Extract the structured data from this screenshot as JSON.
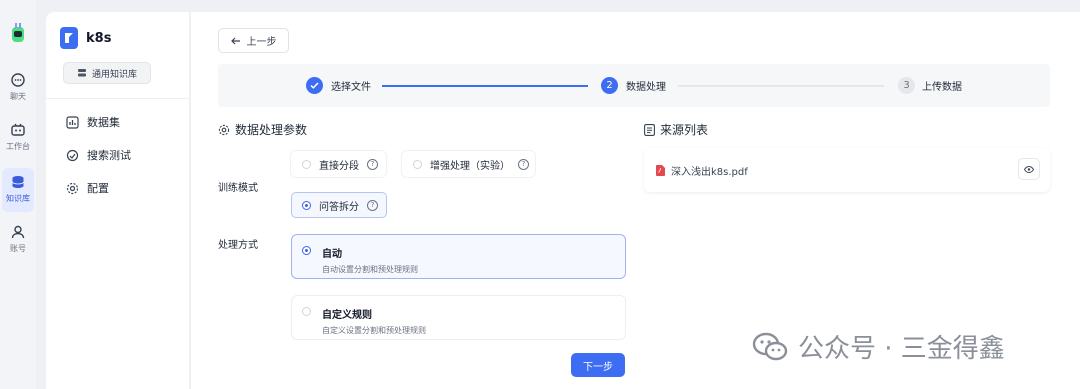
{
  "rail": {
    "items": [
      {
        "label": "聊天",
        "icon": "chat-icon"
      },
      {
        "label": "工作台",
        "icon": "workbench-icon"
      },
      {
        "label": "知识库",
        "icon": "database-icon",
        "active": true
      },
      {
        "label": "账号",
        "icon": "user-icon"
      }
    ]
  },
  "sidebar": {
    "kb_name": "k8s",
    "kb_tag": "通用知识库",
    "nav": [
      {
        "label": "数据集",
        "icon": "dataset-icon"
      },
      {
        "label": "搜索测试",
        "icon": "search-test-icon"
      },
      {
        "label": "配置",
        "icon": "gear-icon"
      }
    ]
  },
  "main": {
    "back_label": "上一步",
    "steps": [
      {
        "number": "1",
        "label": "选择文件",
        "state": "done"
      },
      {
        "number": "2",
        "label": "数据处理",
        "state": "active"
      },
      {
        "number": "3",
        "label": "上传数据",
        "state": "todo"
      }
    ],
    "params_title": "数据处理参数",
    "train_mode": {
      "label": "训练模式",
      "options": [
        {
          "label": "直接分段",
          "selected": false
        },
        {
          "label": "增强处理（实验）",
          "selected": false
        },
        {
          "label": "问答拆分",
          "selected": true
        }
      ]
    },
    "process_mode": {
      "label": "处理方式",
      "options": [
        {
          "title": "自动",
          "desc": "自动设置分割和预处理规则",
          "selected": true
        },
        {
          "title": "自定义规则",
          "desc": "自定义设置分割和预处理规则",
          "selected": false
        }
      ]
    },
    "next_label": "下一步",
    "source_title": "来源列表",
    "files": [
      {
        "name": "深入浅出k8s.pdf"
      }
    ]
  },
  "watermark": "公众号 · 三金得鑫",
  "colors": {
    "accent": "#3d6df2",
    "active_bg": "#e3e9ff"
  }
}
